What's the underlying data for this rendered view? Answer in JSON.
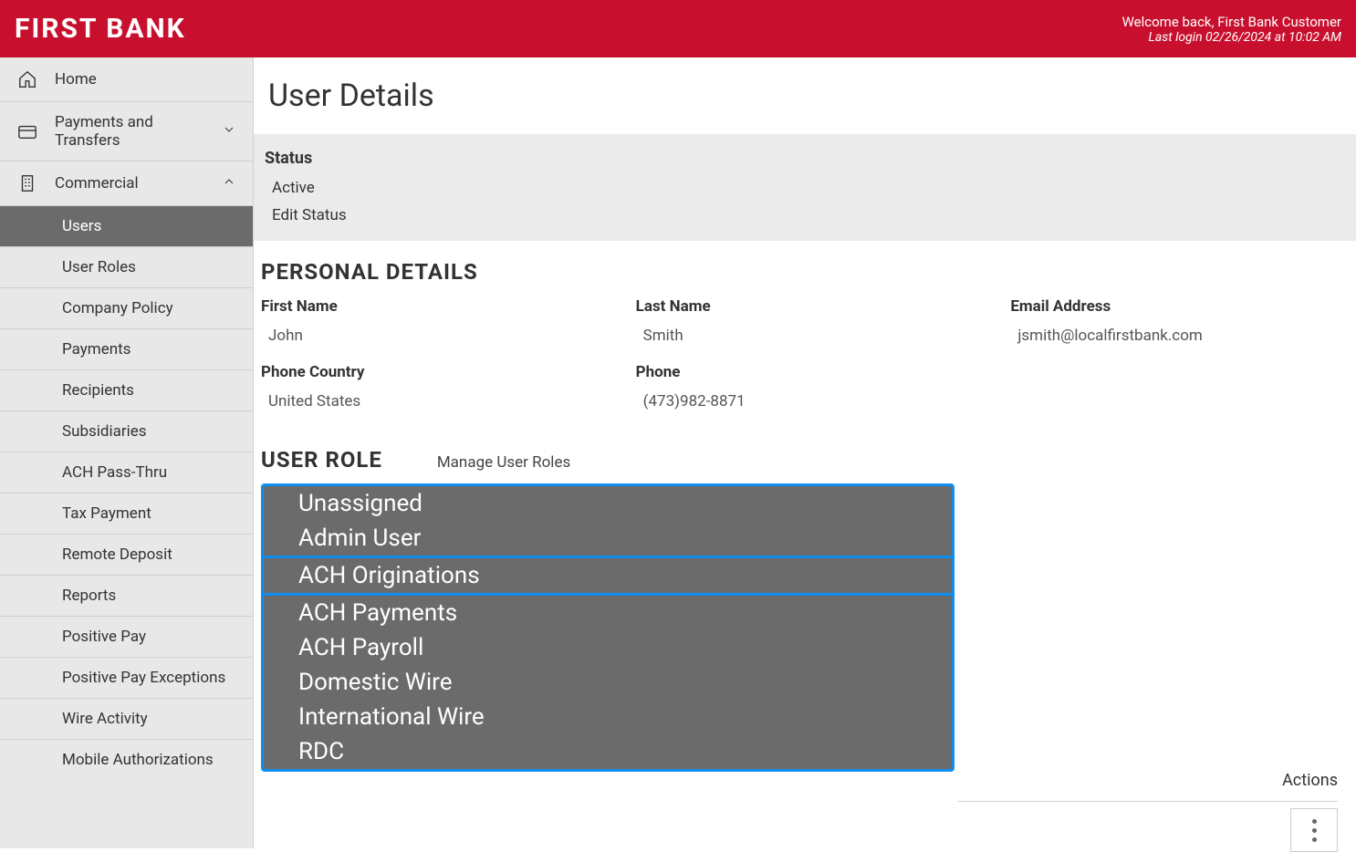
{
  "header": {
    "logo": "FIRST BANK",
    "welcome": "Welcome back, First Bank Customer",
    "last_login": "Last login 02/26/2024 at 10:02 AM"
  },
  "sidebar": {
    "home": "Home",
    "payments": "Payments and Transfers",
    "commercial": "Commercial",
    "sub": {
      "users": "Users",
      "user_roles": "User Roles",
      "company_policy": "Company Policy",
      "payments": "Payments",
      "recipients": "Recipients",
      "subsidiaries": "Subsidiaries",
      "ach_pass": "ACH Pass-Thru",
      "tax_payment": "Tax Payment",
      "remote_deposit": "Remote Deposit",
      "reports": "Reports",
      "positive_pay": "Positive Pay",
      "positive_pay_ex": "Positive Pay Exceptions",
      "wire_activity": "Wire Activity",
      "mobile_auth": "Mobile Authorizations"
    }
  },
  "page": {
    "title": "User Details",
    "status_label": "Status",
    "status_value": "Active",
    "edit_status": "Edit Status",
    "personal_heading": "PERSONAL DETAILS",
    "first_name_label": "First Name",
    "first_name": "John",
    "last_name_label": "Last Name",
    "last_name": "Smith",
    "email_label": "Email Address",
    "email": "jsmith@localfirstbank.com",
    "phone_country_label": "Phone Country",
    "phone_country": "United States",
    "phone_label": "Phone",
    "phone": "(473)982-8871",
    "user_role_heading": "USER ROLE",
    "manage_roles": "Manage User Roles",
    "actions_label": "Actions"
  },
  "roles": {
    "unassigned": "Unassigned",
    "admin": "Admin User",
    "ach_orig": "ACH Originations",
    "ach_pay": "ACH Payments",
    "ach_payroll": "ACH Payroll",
    "domestic": "Domestic Wire",
    "international": "International Wire",
    "rdc": "RDC"
  }
}
